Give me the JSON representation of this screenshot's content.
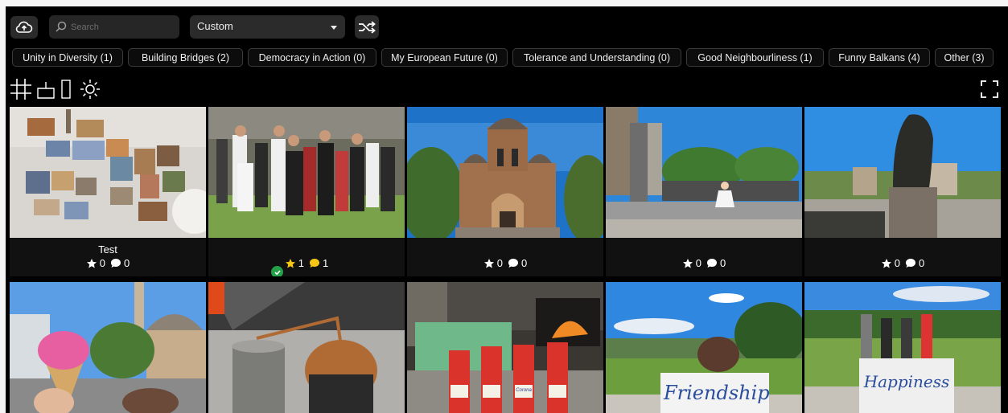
{
  "toolbar": {
    "search_placeholder": "Search",
    "sort_value": "Custom"
  },
  "tags": [
    {
      "label": "Unity in Diversity (1)"
    },
    {
      "label": "Building Bridges (2)"
    },
    {
      "label": "Democracy in Action (0)"
    },
    {
      "label": "My European Future (0)"
    },
    {
      "label": "Tolerance and Understanding (0)"
    },
    {
      "label": "Good Neighbourliness (1)"
    },
    {
      "label": "Funny Balkans (4)"
    },
    {
      "label": "Other (3)"
    }
  ],
  "photos": [
    {
      "title": "Test",
      "stars": "0",
      "comments": "0"
    },
    {
      "title": "",
      "stars": "1",
      "comments": "1"
    },
    {
      "title": "",
      "stars": "0",
      "comments": "0"
    },
    {
      "title": "",
      "stars": "0",
      "comments": "0"
    },
    {
      "title": "",
      "stars": "0",
      "comments": "0"
    }
  ],
  "sign_texts": [
    "Friendship",
    "Happiness"
  ],
  "bottle_labels": [
    "Corona"
  ],
  "colors": {
    "background": "#000000",
    "chip_bg": "#0c0c0c",
    "chip_border": "#3b3b3b",
    "control_bg": "#2b2b2b",
    "star_active": "#f5c518",
    "comment_active": "#f5c518",
    "check_badge": "#24a148"
  },
  "icons": [
    "upload-cloud-icon",
    "search-icon",
    "chevron-down-icon",
    "shuffle-icon",
    "grid-view-icon",
    "collage-view-icon",
    "single-view-icon",
    "brightness-icon",
    "fullscreen-icon",
    "star-icon",
    "comment-icon",
    "check-icon"
  ]
}
